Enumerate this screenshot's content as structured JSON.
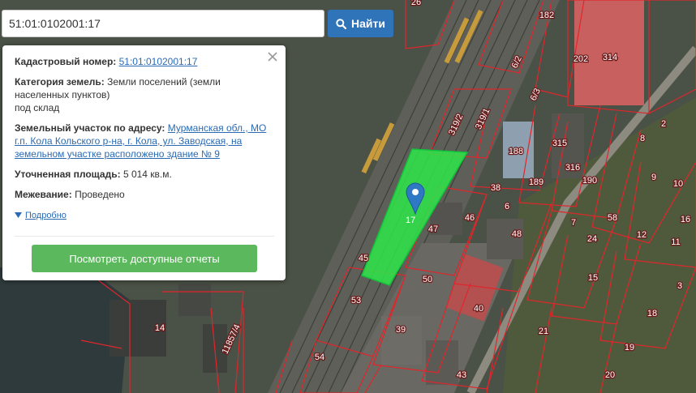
{
  "search": {
    "value": "51:01:0102001:17",
    "button_label": "Найти"
  },
  "card": {
    "cadastral_label": "Кадастровый номер:",
    "cadastral_value": "51:01:0102001:17",
    "category_label": "Категория земель:",
    "category_value_line1": "Земли поселений (земли",
    "category_value_line2": "населенных пунктов)",
    "category_value_line3": "под склад",
    "address_label": "Земельный участок по адресу:",
    "address_line1": "Мурманская обл., МО",
    "address_line2": "г.п. Кола Кольского р-на, г. Кола, ул. Заводская, на",
    "address_line3": "земельном участке расположено здание № 9",
    "area_label": "Уточненная площадь:",
    "area_value": "5 014 кв.м.",
    "survey_label": "Межевание:",
    "survey_value": "Проведено",
    "more_label": "Подробно",
    "reports_button_label": "Посмотреть доступные отчеты"
  },
  "map": {
    "highlight_color": "#2ee84a",
    "boundary_color": "#e0262b",
    "marker_color": "#2f78c4",
    "selected_parcel_label": "17",
    "plot_labels": [
      "26",
      "182",
      "202",
      "314",
      "6/2",
      "6/3",
      "319/2",
      "319/1",
      "188",
      "315",
      "316",
      "189",
      "190",
      "2",
      "8",
      "9",
      "10",
      "38",
      "46",
      "58",
      "7",
      "24",
      "12",
      "11",
      "45",
      "48",
      "15",
      "50",
      "53",
      "40",
      "18",
      "14",
      "11857/4",
      "39",
      "54",
      "43",
      "21",
      "19",
      "20",
      "47",
      "6",
      "16",
      "3"
    ]
  }
}
